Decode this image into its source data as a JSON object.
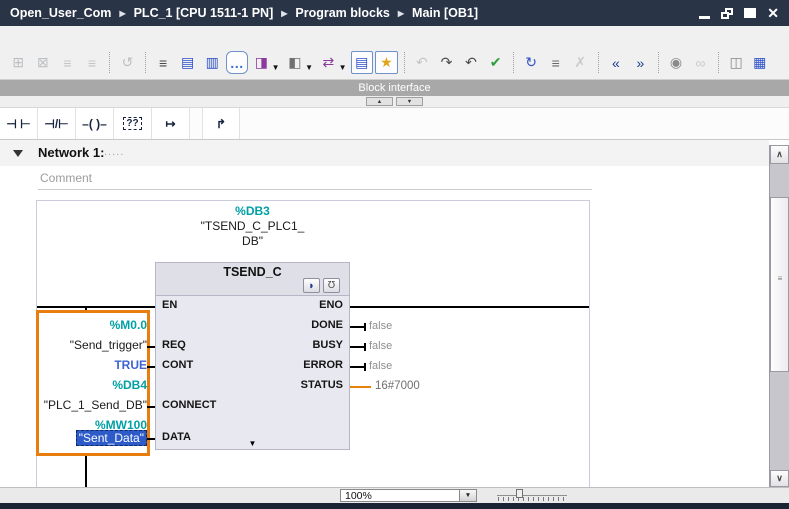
{
  "window": {
    "breadcrumbs": [
      "Open_User_Com",
      "PLC_1 [CPU 1511-1 PN]",
      "Program blocks",
      "Main [OB1]"
    ],
    "separator": "▶",
    "controls": {
      "minimize": "minimize",
      "restore": "restore",
      "maximize": "maximize",
      "close": "✕"
    }
  },
  "toolbar": {
    "icons": [
      {
        "name": "insert-network-icon",
        "glyph": "⊞",
        "color": "#8a8f96",
        "disabled": true
      },
      {
        "name": "delete-network-icon",
        "glyph": "⊠",
        "color": "#8a8f96",
        "disabled": true
      },
      {
        "name": "insert-row-icon",
        "glyph": "≡",
        "color": "#9a9a9a",
        "disabled": true
      },
      {
        "name": "insert-empty-row-icon",
        "glyph": "≡",
        "color": "#9a9a9a",
        "disabled": true
      },
      {
        "sep": true
      },
      {
        "name": "reset-start-values-icon",
        "glyph": "↺",
        "color": "#8a8f96",
        "disabled": true
      },
      {
        "sep": true
      },
      {
        "name": "absolute-operands-icon",
        "glyph": "≡",
        "color": "#4a4a4a"
      },
      {
        "name": "network-view-icon",
        "glyph": "▤",
        "color": "#2d50c8"
      },
      {
        "name": "network-view-alt-icon",
        "glyph": "▥",
        "color": "#2d50c8"
      },
      {
        "name": "toggle-comments-icon",
        "glyph": "…",
        "color": "#3a6fd8",
        "active": true,
        "bubble": true
      },
      {
        "name": "insert-block-call-icon",
        "glyph": "◨",
        "color": "#8a3a9e",
        "dropdown": true
      },
      {
        "name": "insert-segment-icon",
        "glyph": "◧",
        "color": "#707070",
        "dropdown": true
      },
      {
        "name": "insert-move-operation-icon",
        "glyph": "⇄",
        "color": "#8a3a9e",
        "dropdown": true
      },
      {
        "name": "block-interface-toggle-icon",
        "glyph": "▤",
        "color": "#2d50c8",
        "active": true
      },
      {
        "name": "favorites-icon",
        "glyph": "★",
        "color": "#e3a51a",
        "active": true
      },
      {
        "sep": true
      },
      {
        "name": "undo-icon",
        "glyph": "↶",
        "color": "#9a9a9a",
        "disabled": true
      },
      {
        "name": "redo-to-save-icon",
        "glyph": "↷",
        "color": "#4a4a4a"
      },
      {
        "name": "undo-to-save-icon",
        "glyph": "↶",
        "color": "#4a4a4a"
      },
      {
        "name": "compile-icon",
        "glyph": "✔",
        "color": "#2E9E3E"
      },
      {
        "sep": true
      },
      {
        "name": "update-block-calls-icon",
        "glyph": "↻",
        "color": "#2d50c8"
      },
      {
        "name": "expand-statements-icon",
        "glyph": "≡",
        "color": "#6a6a6a"
      },
      {
        "name": "collapse-statements-icon",
        "glyph": "✗",
        "color": "#a5a5a5",
        "disabled": true
      },
      {
        "sep": true
      },
      {
        "name": "go-to-previous-icon",
        "glyph": "«",
        "color": "#1B3C8C"
      },
      {
        "name": "go-to-next-icon",
        "glyph": "»",
        "color": "#1B3C8C"
      },
      {
        "sep": true
      },
      {
        "name": "monitoring-selection-icon",
        "glyph": "◉",
        "color": "#8a8a8a"
      },
      {
        "name": "monitor-glasses-icon",
        "glyph": "∞",
        "color": "#a5a5a5",
        "disabled": true
      },
      {
        "sep": true
      },
      {
        "name": "data-snapshot-icon",
        "glyph": "◫",
        "color": "#8a8a8a"
      },
      {
        "name": "split-editor-icon",
        "glyph": "▦",
        "color": "#2d50c8",
        "right": true
      }
    ]
  },
  "panels": {
    "block_interface_label": "Block interface",
    "collapse_up_glyph": "▲",
    "collapse_down_glyph": "▼"
  },
  "lad_toolbar": {
    "buttons": [
      {
        "name": "normally-open-contact-button",
        "glyph": "⊣ ⊢"
      },
      {
        "name": "normally-closed-contact-button",
        "glyph": "⊣/⊢"
      },
      {
        "name": "coil-button",
        "glyph": "–( )–"
      },
      {
        "name": "empty-box-button",
        "glyph": "??",
        "boxed": true
      },
      {
        "name": "open-branch-button",
        "glyph": "↦"
      },
      {
        "name": "close-branch-button",
        "glyph": "↱",
        "gap": true
      }
    ]
  },
  "network": {
    "title": "Network 1:",
    "title_dots": ".....",
    "comment_placeholder": "Comment"
  },
  "block": {
    "db_address": "%DB3",
    "instance_line1": "\"TSEND_C_PLC1_",
    "instance_line2": "DB\"",
    "title": "TSEND_C",
    "expand_glyph": "▼",
    "header_button1_glyph": "◗",
    "header_button2_glyph": "Ʊ",
    "pins_left": {
      "en": "EN",
      "req": "REQ",
      "cont": "CONT",
      "connect": "CONNECT",
      "data": "DATA"
    },
    "pins_right": {
      "eno": "ENO",
      "done": "DONE",
      "busy": "BUSY",
      "error": "ERROR",
      "status": "STATUS"
    }
  },
  "operands": {
    "req_address": "%M0.0",
    "req_name": "\"Send_trigger\"",
    "cont_value": "TRUE",
    "connect_address": "%DB4",
    "connect_name": "\"PLC_1_Send_DB\"",
    "data_address": "%MW100",
    "data_name": "\"Sent_Data\"",
    "done_value": "false",
    "busy_value": "false",
    "error_value": "false",
    "status_value": "16#7000"
  },
  "status_bar": {
    "zoom_value": "100%",
    "dropdown_glyph": "▼"
  },
  "scrollbar": {
    "up_glyph": "∧",
    "down_glyph": "∨",
    "grip_glyph": "≡"
  },
  "colors": {
    "address_teal": "#00A0A5",
    "constant_blue": "#3E64D2",
    "selection_blue": "#2D5BC8",
    "highlight_orange": "#E87E10",
    "status_line_orange": "#E8820C",
    "monitor_value_gray": "#8F8F8F",
    "titlebar_navy": "#2A3447"
  }
}
